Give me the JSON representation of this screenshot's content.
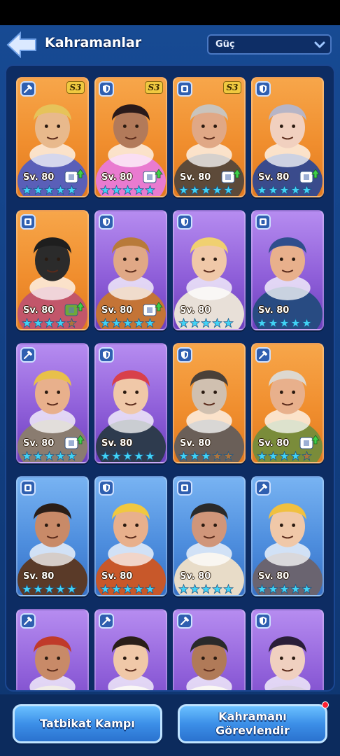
{
  "header": {
    "title": "Kahramanlar",
    "sort_value": "Güç"
  },
  "heroes": [
    {
      "color": "orange",
      "class": "sword",
      "rank": "S3",
      "level": "Sv. 80",
      "stars": 5,
      "gear": "upgrade",
      "skin": "#e8b98c",
      "hair": "#e6c35a",
      "outfit": "#5a5fb8"
    },
    {
      "color": "orange",
      "class": "shield",
      "rank": "S3",
      "level": "Sv. 80",
      "stars": 5,
      "gear": "upgrade",
      "skin": "#b27a5a",
      "hair": "#2a1a1a",
      "outfit": "#e97bd0"
    },
    {
      "color": "orange",
      "class": "defense",
      "rank": "S3",
      "level": "Sv. 80",
      "stars": 5,
      "gear": "upgrade",
      "skin": "#e0a886",
      "hair": "#c9c4bd",
      "outfit": "#5d4a39"
    },
    {
      "color": "orange",
      "class": "shield",
      "rank": "",
      "level": "Sv. 80",
      "stars": 5,
      "gear": "upgrade",
      "skin": "#f1d0bf",
      "hair": "#b7b5c6",
      "outfit": "#3a4b8c"
    },
    {
      "color": "orange",
      "class": "defense",
      "rank": "",
      "level": "Sv. 80",
      "stars": 4,
      "gear": "upgrade-green",
      "skin": "#2b2b2b",
      "hair": "#1e1e1e",
      "outfit": "#c2566a"
    },
    {
      "color": "purple",
      "class": "shield",
      "rank": "",
      "level": "Sv. 80",
      "stars": 5,
      "gear": "upgrade",
      "skin": "#e0a886",
      "hair": "#b87a3a",
      "outfit": "#c47436"
    },
    {
      "color": "purple",
      "class": "shield",
      "rank": "",
      "level": "Sv. 80",
      "stars": 5,
      "gear": "",
      "skin": "#f0c8a8",
      "hair": "#f0d070",
      "outfit": "#e8e0d8"
    },
    {
      "color": "purple",
      "class": "defense",
      "rank": "",
      "level": "Sv. 80",
      "stars": 5,
      "gear": "",
      "skin": "#e8b08c",
      "hair": "#2f4e8c",
      "outfit": "#284b82"
    },
    {
      "color": "purple",
      "class": "sword",
      "rank": "",
      "level": "Sv. 80",
      "stars": 5,
      "gear": "upgrade",
      "skin": "#e8b08c",
      "hair": "#e8c04a",
      "outfit": "#8a7c70"
    },
    {
      "color": "purple",
      "class": "shield",
      "rank": "",
      "level": "Sv. 80",
      "stars": 5,
      "gear": "",
      "skin": "#f0c8a8",
      "hair": "#d8404a",
      "outfit": "#2e3b4e"
    },
    {
      "color": "orange",
      "class": "shield",
      "rank": "",
      "level": "Sv. 80",
      "stars": 3,
      "gear": "",
      "skin": "#d0c0b0",
      "hair": "#4a4038",
      "outfit": "#6a5f58"
    },
    {
      "color": "orange",
      "class": "sword",
      "rank": "",
      "level": "Sv. 80",
      "stars": 4,
      "gear": "upgrade",
      "skin": "#e8b08c",
      "hair": "#ddd8d0",
      "outfit": "#7a8c3a"
    },
    {
      "color": "blue",
      "class": "defense",
      "rank": "",
      "level": "Sv. 80",
      "stars": 5,
      "gear": "",
      "skin": "#c88a68",
      "hair": "#2a1e18",
      "outfit": "#5a3a28"
    },
    {
      "color": "blue",
      "class": "shield",
      "rank": "",
      "level": "Sv. 80",
      "stars": 5,
      "gear": "",
      "skin": "#e8b08c",
      "hair": "#f0c840",
      "outfit": "#c8582a"
    },
    {
      "color": "blue",
      "class": "defense",
      "rank": "",
      "level": "Sv. 80",
      "stars": 5,
      "gear": "",
      "skin": "#d0967a",
      "hair": "#2a2a2a",
      "outfit": "#e8dcc8"
    },
    {
      "color": "blue",
      "class": "sword",
      "rank": "",
      "level": "Sv. 80",
      "stars": 5,
      "gear": "",
      "skin": "#f0c8a8",
      "hair": "#f0c040",
      "outfit": "#6a6470"
    },
    {
      "color": "purple",
      "class": "sword",
      "rank": "",
      "level": "",
      "stars": 0,
      "gear": "",
      "skin": "#c88a68",
      "hair": "#c03a2a",
      "outfit": "#c8b8a0"
    },
    {
      "color": "purple",
      "class": "sword",
      "rank": "",
      "level": "",
      "stars": 0,
      "gear": "",
      "skin": "#f0c8a8",
      "hair": "#2a1e18",
      "outfit": "#e8e0d8"
    },
    {
      "color": "purple",
      "class": "sword",
      "rank": "",
      "level": "",
      "stars": 0,
      "gear": "",
      "skin": "#b07a58",
      "hair": "#2a2a2a",
      "outfit": "#e8e0d0"
    },
    {
      "color": "purple",
      "class": "shield",
      "rank": "",
      "level": "",
      "stars": 0,
      "gear": "",
      "skin": "#f0d0c0",
      "hair": "#2a1e38",
      "outfit": "#6a4a8a"
    }
  ],
  "buttons": {
    "training_camp": "Tatbikat Kampı",
    "assign_hero_line1": "Kahramanı",
    "assign_hero_line2": "Görevlendir"
  },
  "colors": {
    "star": "#42d3f5",
    "star_empty": "#b0743a",
    "accent": "#3c8fe8"
  }
}
